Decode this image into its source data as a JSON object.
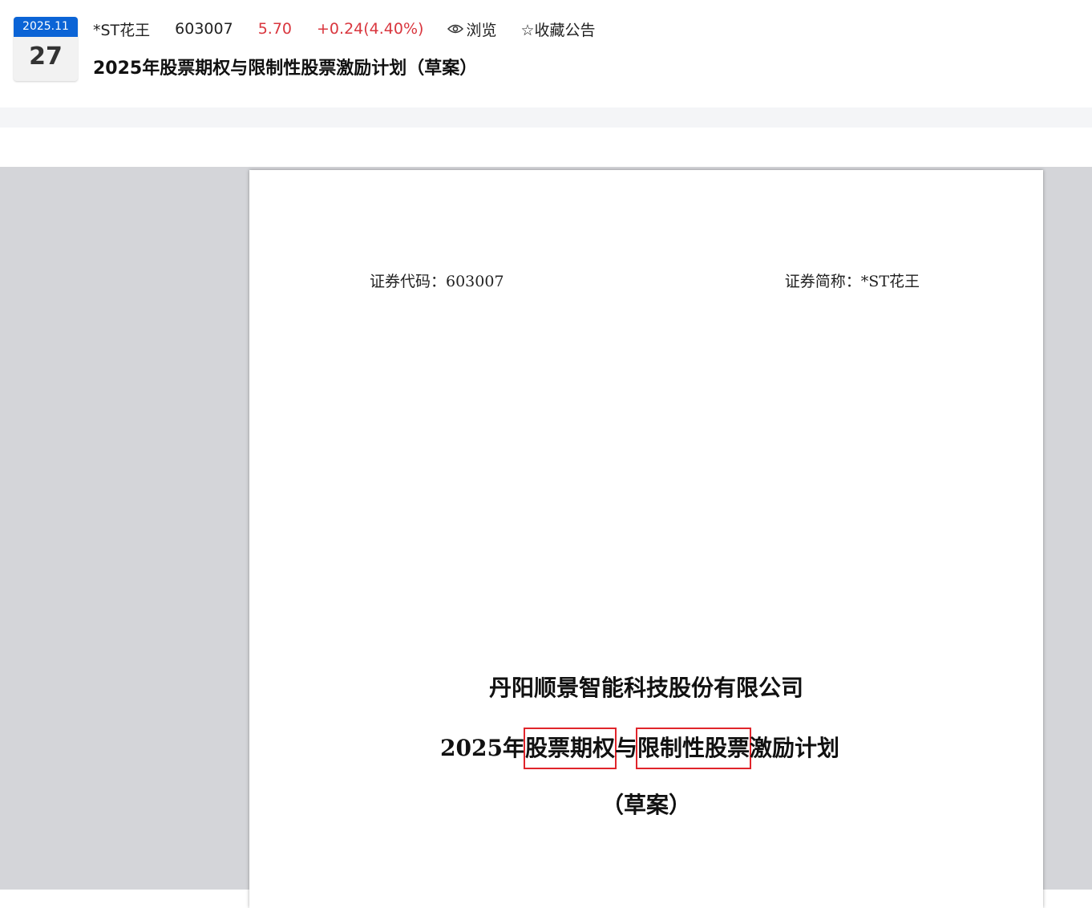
{
  "header": {
    "date": {
      "year_month": "2025.11",
      "day": "27"
    },
    "stock_name": "*ST花王",
    "stock_code": "603007",
    "price": "5.70",
    "change": "+0.24(4.40%)",
    "view_label": "浏览",
    "favorite_label": "☆收藏公告",
    "title": "2025年股票期权与限制性股票激励计划（草案）"
  },
  "document": {
    "security_code": "证券代码：603007",
    "security_abbr": "证券简称：*ST花王",
    "company": "丹阳顺景智能科技股份有限公司",
    "plan_title": {
      "prefix": "2025年",
      "highlight1": "股票期权",
      "middle": "与",
      "highlight2": "限制性股票",
      "suffix": "激励计划"
    },
    "draft": "（草案）"
  },
  "colors": {
    "accent_blue": "#0b64d6",
    "price_red": "#d9363e",
    "highlight_red": "#e0252b",
    "viewer_bg": "#d4d5d9"
  }
}
